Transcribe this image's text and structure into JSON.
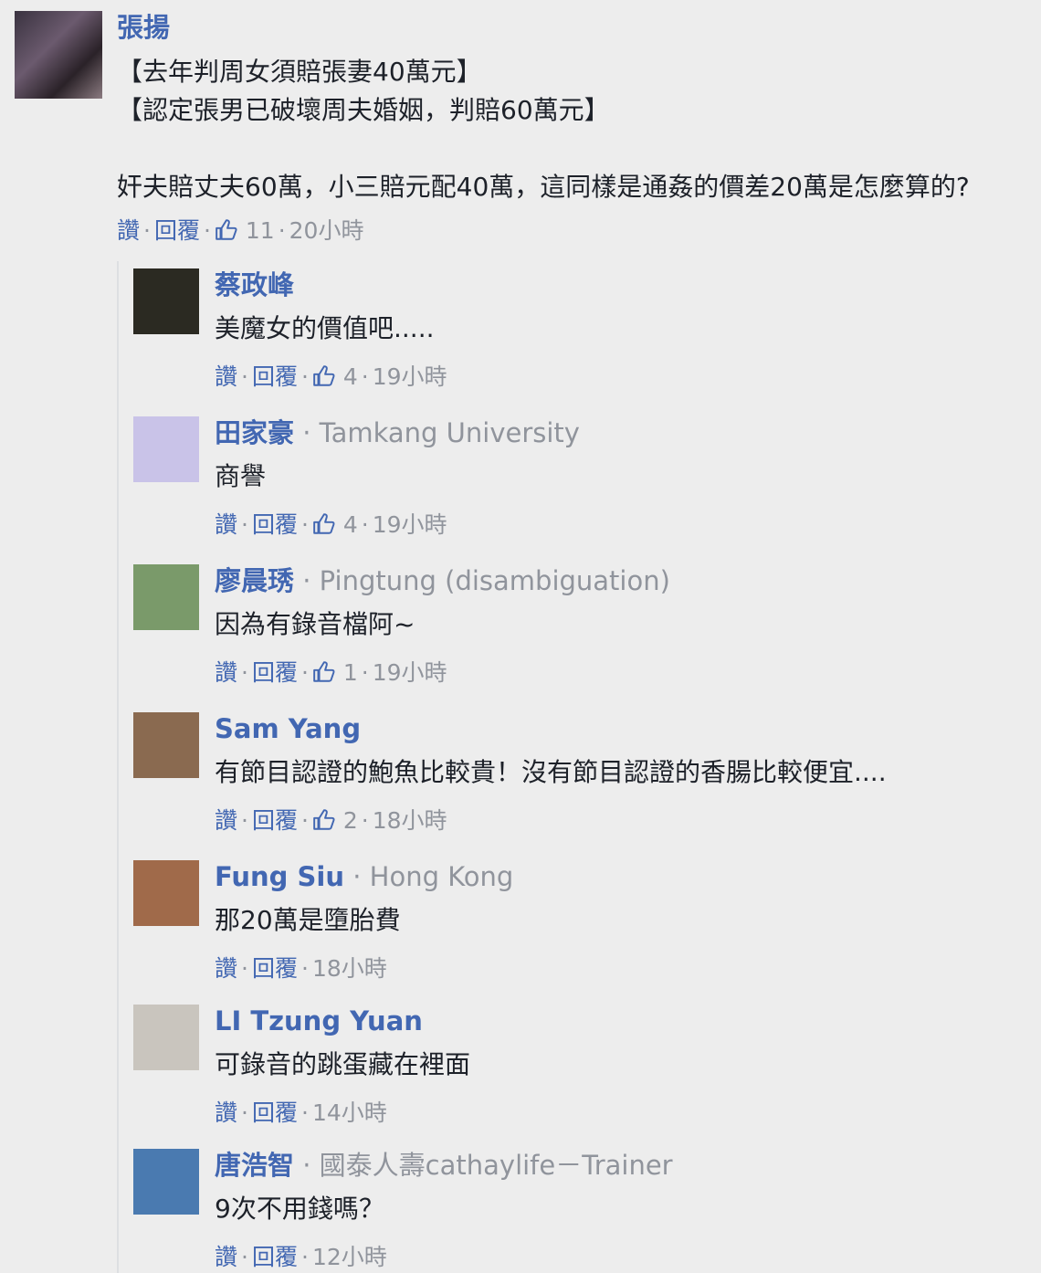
{
  "main": {
    "author": "張揚",
    "lines": [
      "【去年判周女須賠張妻40萬元】",
      "【認定張男已破壞周夫婚姻，判賠60萬元】",
      "",
      "奸夫賠丈夫60萬，小三賠元配40萬，這同樣是通姦的價差20萬是怎麼算的?"
    ],
    "like_label": "讚",
    "reply_label": "回覆",
    "like_count": "11",
    "time": "20小時"
  },
  "replies": [
    {
      "author": "蔡政峰",
      "sub": "",
      "text": "美魔女的價值吧.....",
      "like_label": "讚",
      "reply_label": "回覆",
      "like_count": "4",
      "time": "19小時",
      "avatar_color": "#2b2a22"
    },
    {
      "author": "田家豪",
      "sub": "Tamkang University",
      "text": "商譽",
      "like_label": "讚",
      "reply_label": "回覆",
      "like_count": "4",
      "time": "19小時",
      "avatar_color": "#c9c3e8"
    },
    {
      "author": "廖晨琇",
      "sub": "Pingtung (disambiguation)",
      "text": "因為有錄音檔阿~",
      "like_label": "讚",
      "reply_label": "回覆",
      "like_count": "1",
      "time": "19小時",
      "avatar_color": "#7a9a6a"
    },
    {
      "author": "Sam Yang",
      "sub": "",
      "text": "有節目認證的鮑魚比較貴！沒有節目認證的香腸比較便宜....",
      "like_label": "讚",
      "reply_label": "回覆",
      "like_count": "2",
      "time": "18小時",
      "avatar_color": "#8a6a50"
    },
    {
      "author": "Fung Siu",
      "sub": "Hong Kong",
      "text": "那20萬是墮胎費",
      "like_label": "讚",
      "reply_label": "回覆",
      "like_count": "",
      "time": "18小時",
      "avatar_color": "#a06a4a"
    },
    {
      "author": "LI Tzung Yuan",
      "sub": "",
      "text": "可錄音的跳蛋藏在裡面",
      "like_label": "讚",
      "reply_label": "回覆",
      "like_count": "",
      "time": "14小時",
      "avatar_color": "#c9c5be"
    },
    {
      "author": "唐浩智",
      "sub": "國泰人壽cathaylife－Trainer",
      "text": "9次不用錢嗎？",
      "like_label": "讚",
      "reply_label": "回覆",
      "like_count": "",
      "time": "12小時",
      "avatar_color": "#4a7ab0"
    }
  ]
}
